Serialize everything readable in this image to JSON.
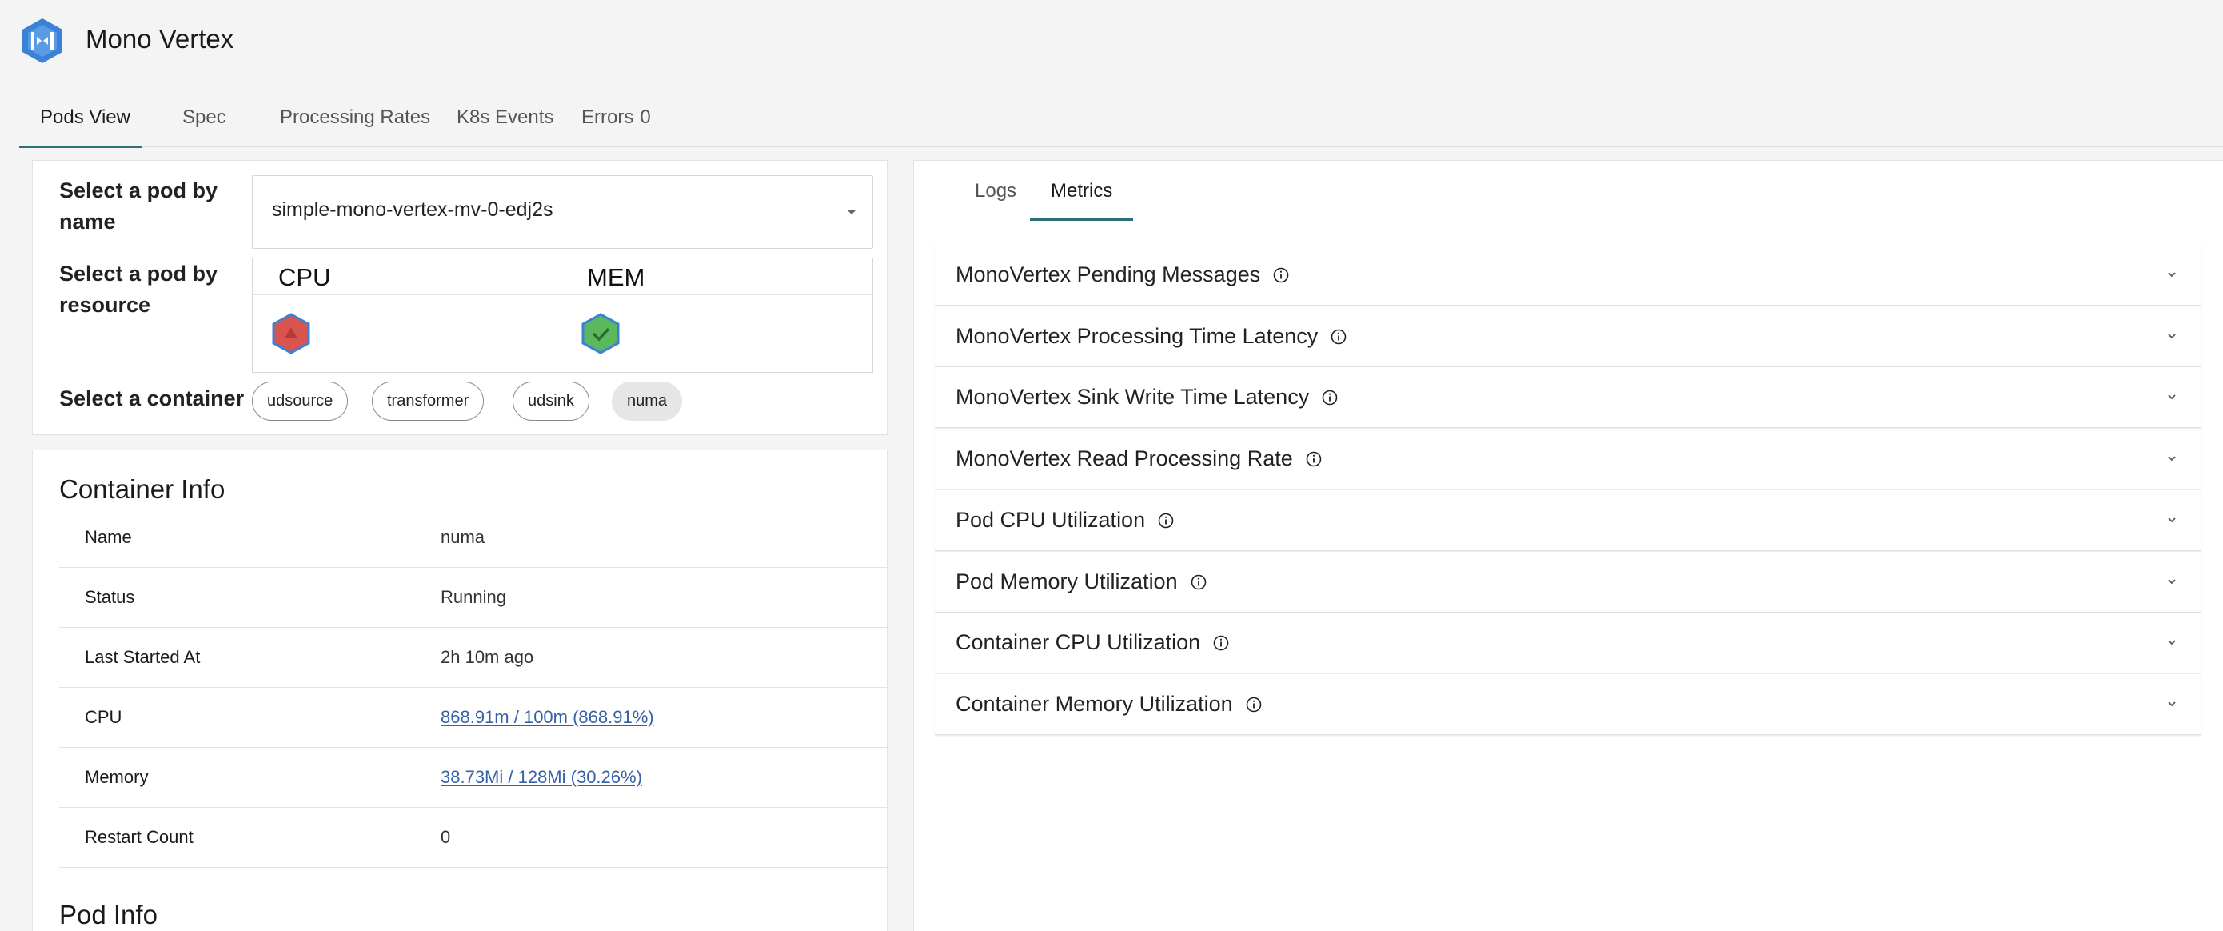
{
  "app": {
    "title": "Mono Vertex",
    "logo_icon": "vertex-logo-icon"
  },
  "tabs": [
    {
      "label": "Pods View",
      "active": true
    },
    {
      "label": "Spec",
      "active": false
    },
    {
      "label": "Processing Rates",
      "active": false
    },
    {
      "label": "K8s Events",
      "active": false
    },
    {
      "label": "Errors",
      "count": "0",
      "active": false
    }
  ],
  "pod_selector": {
    "name_label": "Select a pod by name",
    "name_value": "simple-mono-vertex-mv-0-edj2s",
    "resource_label": "Select a pod by resource",
    "resources": [
      {
        "label": "CPU",
        "status": "error",
        "color": "#d9534f"
      },
      {
        "label": "MEM",
        "status": "healthy",
        "color": "#5cb85c"
      }
    ],
    "container_label": "Select a container",
    "containers": [
      "udsource",
      "transformer",
      "udsink",
      "numa"
    ],
    "selected_container": "numa"
  },
  "container_info": {
    "title": "Container Info",
    "rows": [
      {
        "key": "Name",
        "value": "numa"
      },
      {
        "key": "Status",
        "value": "Running"
      },
      {
        "key": "Last Started At",
        "value": "2h 10m ago"
      },
      {
        "key": "CPU",
        "value": "868.91m / 100m (868.91%)"
      },
      {
        "key": "Memory",
        "value": "38.73Mi / 128Mi (30.26%)"
      },
      {
        "key": "Restart Count",
        "value": "0"
      }
    ]
  },
  "pod_info": {
    "title": "Pod Info"
  },
  "right_panel": {
    "tabs": [
      {
        "label": "Logs",
        "active": false
      },
      {
        "label": "Metrics",
        "active": true
      }
    ],
    "metrics": [
      "MonoVertex Pending Messages",
      "MonoVertex Processing Time Latency",
      "MonoVertex Sink Write Time Latency",
      "MonoVertex Read Processing Rate",
      "Pod CPU Utilization",
      "Pod Memory Utilization",
      "Container CPU Utilization",
      "Container Memory Utilization"
    ]
  },
  "colors": {
    "accent": "#2e6f7e",
    "link": "#3561a8",
    "brand": "#3b82d6"
  }
}
